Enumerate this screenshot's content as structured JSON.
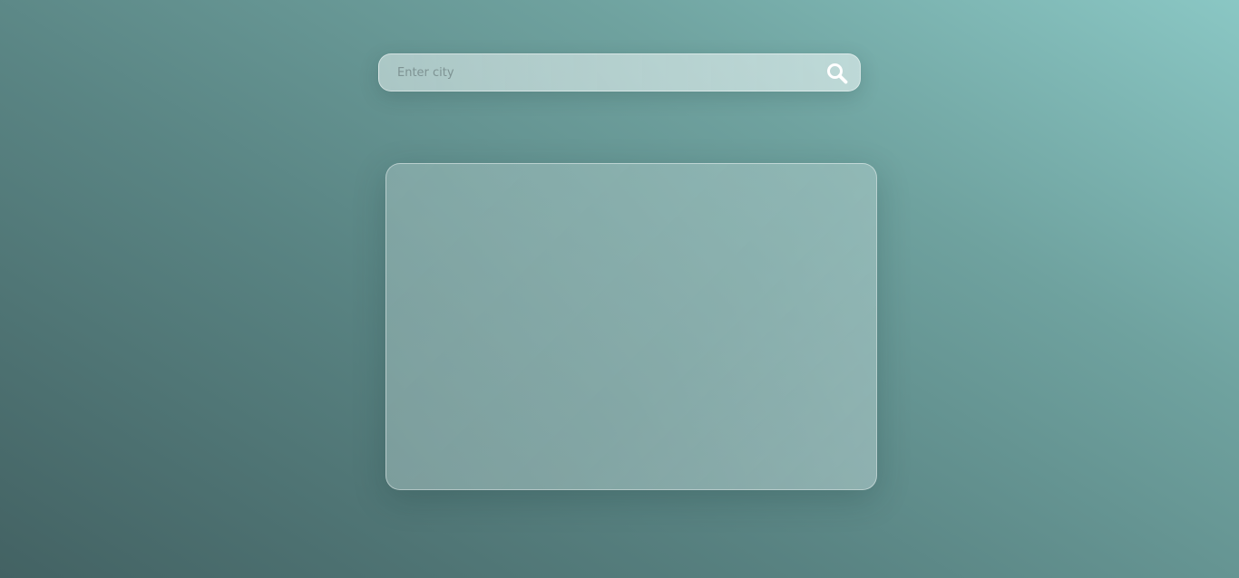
{
  "search": {
    "placeholder": "Enter city",
    "value": "",
    "icon": "search-icon",
    "icon_color": "#ffffff"
  },
  "weather_card": {
    "content": ""
  },
  "colors": {
    "background_dark": "#436263",
    "background_light": "#8ac7c4"
  }
}
